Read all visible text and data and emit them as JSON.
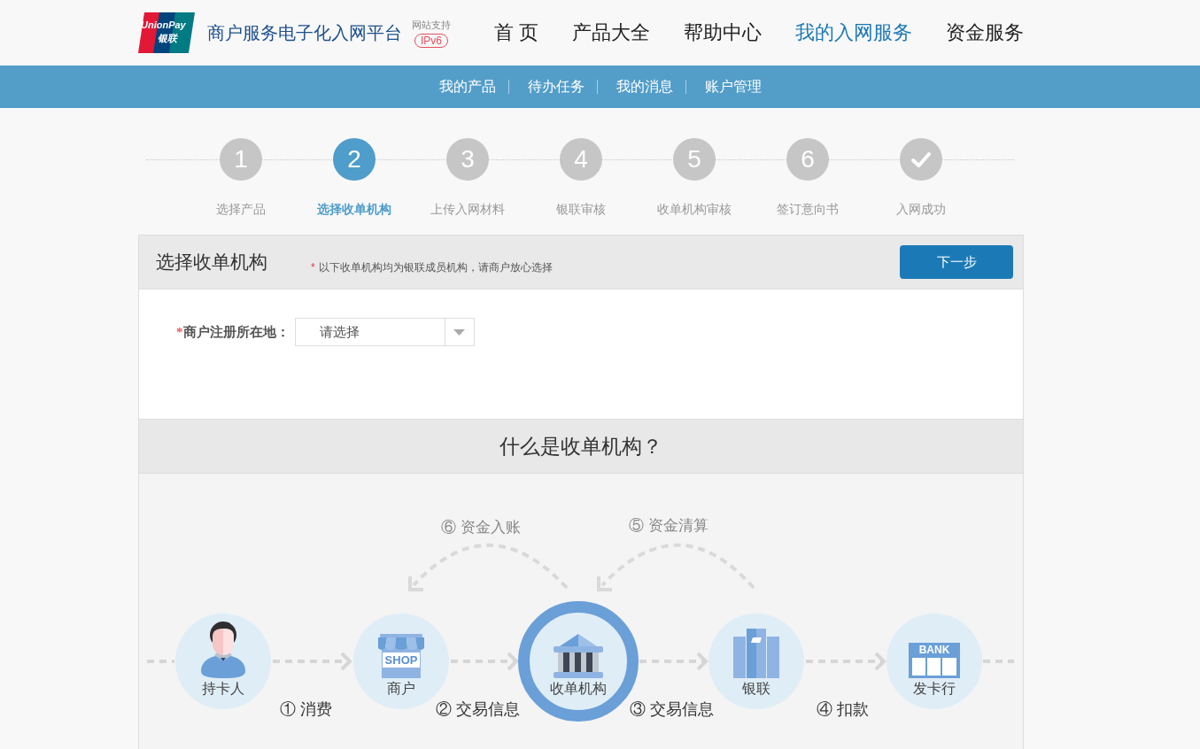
{
  "header": {
    "logo": {
      "latin": "UnionPay",
      "chinese": "银联"
    },
    "title": "商户服务电子化入网平台",
    "ipv6": {
      "caption": "网站支持",
      "badge": "IPv6"
    }
  },
  "nav": [
    {
      "label": "首 页",
      "selected": false
    },
    {
      "label": "产品大全",
      "selected": false
    },
    {
      "label": "帮助中心",
      "selected": false
    },
    {
      "label": "我的入网服务",
      "selected": true
    },
    {
      "label": "资金服务",
      "selected": false
    }
  ],
  "subnav": [
    "我的产品",
    "待办任务",
    "我的消息",
    "账户管理"
  ],
  "steps": [
    {
      "kind": "number",
      "number": "1",
      "label": "选择产品",
      "selected": false
    },
    {
      "kind": "number",
      "number": "2",
      "label": "选择收单机构",
      "selected": true
    },
    {
      "kind": "number",
      "number": "3",
      "label": "上传入网材料",
      "selected": false
    },
    {
      "kind": "number",
      "number": "4",
      "label": "银联审核",
      "selected": false
    },
    {
      "kind": "number",
      "number": "5",
      "label": "收单机构审核",
      "selected": false
    },
    {
      "kind": "number",
      "number": "6",
      "label": "签订意向书",
      "selected": false
    },
    {
      "kind": "check",
      "label": "入网成功",
      "selected": false
    }
  ],
  "panel": {
    "title": "选择收单机构",
    "note_mark": "*",
    "note": "以下收单机构均为银联成员机构，请商户放心选择",
    "next_button": "下一步"
  },
  "form": {
    "fields": [
      {
        "mark": "*",
        "label": "商户注册所在地：",
        "placeholder": "请选择"
      }
    ]
  },
  "explainer": {
    "title": "什么是收单机构？",
    "nodes": [
      {
        "kind": "cardholder",
        "label": "持卡人",
        "highlighted": false
      },
      {
        "kind": "shop",
        "label": "商户",
        "sign": "SHOP",
        "highlighted": false
      },
      {
        "kind": "acquirer",
        "label": "收单机构",
        "highlighted": true
      },
      {
        "kind": "union",
        "label": "银联",
        "highlighted": false
      },
      {
        "kind": "bank",
        "label": "发卡行",
        "sign": "BANK",
        "highlighted": false
      }
    ],
    "flows": [
      "① 消费",
      "② 交易信息",
      "③ 交易信息",
      "④ 扣款"
    ],
    "returns": [
      "⑥ 资金入账",
      "⑤ 资金清算"
    ]
  }
}
